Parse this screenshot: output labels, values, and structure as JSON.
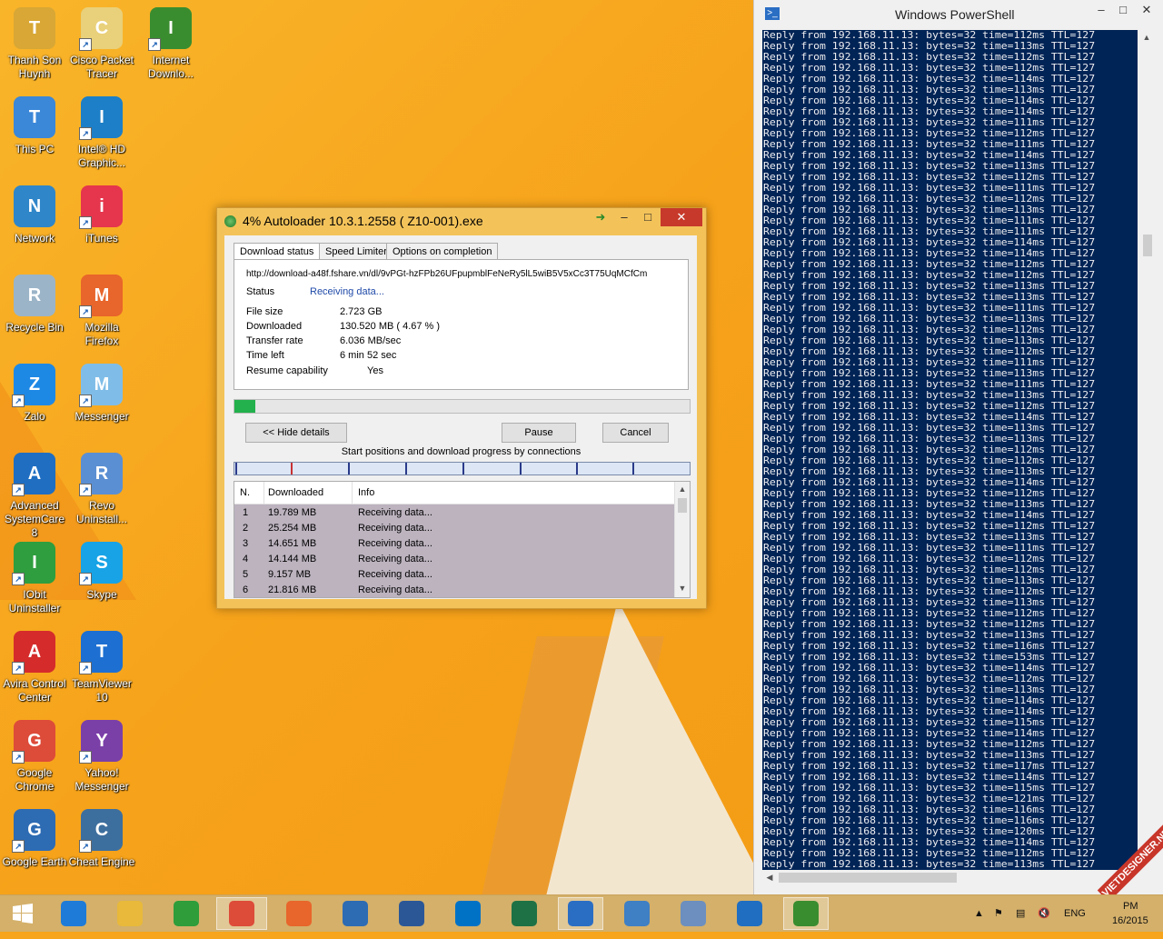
{
  "desktop": {
    "icons": [
      {
        "label": "Thanh Son Huynh",
        "icon": "user-folder-icon",
        "color": "#d8a735"
      },
      {
        "label": "Cisco Packet Tracer",
        "icon": "packet-tracer-icon",
        "color": "#e9d07a"
      },
      {
        "label": "Internet Downlo...",
        "icon": "internet-download-manager-icon",
        "color": "#3a8d2f"
      },
      {
        "label": "This PC",
        "icon": "this-pc-icon",
        "color": "#3b87d8"
      },
      {
        "label": "Intel® HD Graphic...",
        "icon": "intel-graphics-icon",
        "color": "#1d7fc7"
      },
      {
        "label": "Network",
        "icon": "network-icon",
        "color": "#2f86c9"
      },
      {
        "label": "iTunes",
        "icon": "itunes-icon",
        "color": "#e5364d"
      },
      {
        "label": "Recycle Bin",
        "icon": "recycle-bin-icon",
        "color": "#9bb4c8"
      },
      {
        "label": "Mozilla Firefox",
        "icon": "firefox-icon",
        "color": "#e8652b"
      },
      {
        "label": "Zalo",
        "icon": "zalo-icon",
        "color": "#1e88e5"
      },
      {
        "label": "Messenger",
        "icon": "messenger-icon",
        "color": "#7fbde8"
      },
      {
        "label": "Advanced SystemCare 8",
        "icon": "advanced-systemcare-icon",
        "color": "#1f6ec2"
      },
      {
        "label": "Revo Uninstall...",
        "icon": "revo-uninstaller-icon",
        "color": "#5b8fd3"
      },
      {
        "label": "IObit Uninstaller",
        "icon": "iobit-uninstaller-icon",
        "color": "#2e9e3e"
      },
      {
        "label": "Skype",
        "icon": "skype-icon",
        "color": "#17a3e6"
      },
      {
        "label": "Avira Control Center",
        "icon": "avira-icon",
        "color": "#d52b2b"
      },
      {
        "label": "TeamViewer 10",
        "icon": "teamviewer-icon",
        "color": "#1d6fd1"
      },
      {
        "label": "Google Chrome",
        "icon": "chrome-icon",
        "color": "#dd4b39"
      },
      {
        "label": "Yahoo! Messenger",
        "icon": "yahoo-messenger-icon",
        "color": "#7b3fa8"
      },
      {
        "label": "Google Earth",
        "icon": "google-earth-icon",
        "color": "#2d6bb3"
      },
      {
        "label": "Cheat Engine",
        "icon": "cheat-engine-icon",
        "color": "#3d6f9e"
      }
    ]
  },
  "autoloader": {
    "title": "4% Autoloader 10.3.1.2558 ( Z10-001).exe",
    "tabs": [
      "Download status",
      "Speed Limiter",
      "Options on completion"
    ],
    "url": "http://download-a48f.fshare.vn/dl/9vPGt-hzFPb26UFpupmblFeNeRy5lL5wiB5V5xCc3T75UqMCfCm",
    "status_label": "Status",
    "status_value": "Receiving data...",
    "file_size_label": "File size",
    "file_size_value": "2.723  GB",
    "downloaded_label": "Downloaded",
    "downloaded_value": "130.520  MB  ( 4.67 % )",
    "transfer_rate_label": "Transfer rate",
    "transfer_rate_value": "6.036  MB/sec",
    "time_left_label": "Time left",
    "time_left_value": "6 min 52 sec",
    "resume_label": "Resume capability",
    "resume_value": "Yes",
    "progress_fraction": 0.0467,
    "hide_details_label": "<< Hide details",
    "pause_label": "Pause",
    "cancel_label": "Cancel",
    "connections_caption": "Start positions and download progress by connections",
    "table_headers": [
      "N.",
      "Downloaded",
      "Info"
    ],
    "rows": [
      {
        "n": "1",
        "downloaded": "19.789  MB",
        "info": "Receiving data..."
      },
      {
        "n": "2",
        "downloaded": "25.254  MB",
        "info": "Receiving data..."
      },
      {
        "n": "3",
        "downloaded": "14.651  MB",
        "info": "Receiving data..."
      },
      {
        "n": "4",
        "downloaded": "14.144  MB",
        "info": "Receiving data..."
      },
      {
        "n": "5",
        "downloaded": "9.157  MB",
        "info": "Receiving data..."
      },
      {
        "n": "6",
        "downloaded": "21.816  MB",
        "info": "Receiving data..."
      }
    ]
  },
  "powershell": {
    "title": "Windows PowerShell",
    "lines": [
      "Reply from 192.168.11.13: bytes=32 time=112ms TTL=127",
      "Reply from 192.168.11.13: bytes=32 time=113ms TTL=127",
      "Reply from 192.168.11.13: bytes=32 time=112ms TTL=127",
      "Reply from 192.168.11.13: bytes=32 time=112ms TTL=127",
      "Reply from 192.168.11.13: bytes=32 time=114ms TTL=127",
      "Reply from 192.168.11.13: bytes=32 time=113ms TTL=127",
      "Reply from 192.168.11.13: bytes=32 time=114ms TTL=127",
      "Reply from 192.168.11.13: bytes=32 time=114ms TTL=127",
      "Reply from 192.168.11.13: bytes=32 time=111ms TTL=127",
      "Reply from 192.168.11.13: bytes=32 time=112ms TTL=127",
      "Reply from 192.168.11.13: bytes=32 time=111ms TTL=127",
      "Reply from 192.168.11.13: bytes=32 time=114ms TTL=127",
      "Reply from 192.168.11.13: bytes=32 time=113ms TTL=127",
      "Reply from 192.168.11.13: bytes=32 time=112ms TTL=127",
      "Reply from 192.168.11.13: bytes=32 time=111ms TTL=127",
      "Reply from 192.168.11.13: bytes=32 time=112ms TTL=127",
      "Reply from 192.168.11.13: bytes=32 time=113ms TTL=127",
      "Reply from 192.168.11.13: bytes=32 time=111ms TTL=127",
      "Reply from 192.168.11.13: bytes=32 time=111ms TTL=127",
      "Reply from 192.168.11.13: bytes=32 time=114ms TTL=127",
      "Reply from 192.168.11.13: bytes=32 time=114ms TTL=127",
      "Reply from 192.168.11.13: bytes=32 time=112ms TTL=127",
      "Reply from 192.168.11.13: bytes=32 time=112ms TTL=127",
      "Reply from 192.168.11.13: bytes=32 time=113ms TTL=127",
      "Reply from 192.168.11.13: bytes=32 time=113ms TTL=127",
      "Reply from 192.168.11.13: bytes=32 time=111ms TTL=127",
      "Reply from 192.168.11.13: bytes=32 time=113ms TTL=127",
      "Reply from 192.168.11.13: bytes=32 time=112ms TTL=127",
      "Reply from 192.168.11.13: bytes=32 time=113ms TTL=127",
      "Reply from 192.168.11.13: bytes=32 time=112ms TTL=127",
      "Reply from 192.168.11.13: bytes=32 time=111ms TTL=127",
      "Reply from 192.168.11.13: bytes=32 time=113ms TTL=127",
      "Reply from 192.168.11.13: bytes=32 time=111ms TTL=127",
      "Reply from 192.168.11.13: bytes=32 time=113ms TTL=127",
      "Reply from 192.168.11.13: bytes=32 time=112ms TTL=127",
      "Reply from 192.168.11.13: bytes=32 time=114ms TTL=127",
      "Reply from 192.168.11.13: bytes=32 time=113ms TTL=127",
      "Reply from 192.168.11.13: bytes=32 time=113ms TTL=127",
      "Reply from 192.168.11.13: bytes=32 time=112ms TTL=127",
      "Reply from 192.168.11.13: bytes=32 time=112ms TTL=127",
      "Reply from 192.168.11.13: bytes=32 time=113ms TTL=127",
      "Reply from 192.168.11.13: bytes=32 time=114ms TTL=127",
      "Reply from 192.168.11.13: bytes=32 time=112ms TTL=127",
      "Reply from 192.168.11.13: bytes=32 time=113ms TTL=127",
      "Reply from 192.168.11.13: bytes=32 time=114ms TTL=127",
      "Reply from 192.168.11.13: bytes=32 time=112ms TTL=127",
      "Reply from 192.168.11.13: bytes=32 time=113ms TTL=127",
      "Reply from 192.168.11.13: bytes=32 time=111ms TTL=127",
      "Reply from 192.168.11.13: bytes=32 time=112ms TTL=127",
      "Reply from 192.168.11.13: bytes=32 time=112ms TTL=127",
      "Reply from 192.168.11.13: bytes=32 time=113ms TTL=127",
      "Reply from 192.168.11.13: bytes=32 time=112ms TTL=127",
      "Reply from 192.168.11.13: bytes=32 time=113ms TTL=127",
      "Reply from 192.168.11.13: bytes=32 time=112ms TTL=127",
      "Reply from 192.168.11.13: bytes=32 time=112ms TTL=127",
      "Reply from 192.168.11.13: bytes=32 time=113ms TTL=127",
      "Reply from 192.168.11.13: bytes=32 time=116ms TTL=127",
      "Reply from 192.168.11.13: bytes=32 time=153ms TTL=127",
      "Reply from 192.168.11.13: bytes=32 time=114ms TTL=127",
      "Reply from 192.168.11.13: bytes=32 time=112ms TTL=127",
      "Reply from 192.168.11.13: bytes=32 time=113ms TTL=127",
      "Reply from 192.168.11.13: bytes=32 time=114ms TTL=127",
      "Reply from 192.168.11.13: bytes=32 time=114ms TTL=127",
      "Reply from 192.168.11.13: bytes=32 time=115ms TTL=127",
      "Reply from 192.168.11.13: bytes=32 time=114ms TTL=127",
      "Reply from 192.168.11.13: bytes=32 time=112ms TTL=127",
      "Reply from 192.168.11.13: bytes=32 time=113ms TTL=127",
      "Reply from 192.168.11.13: bytes=32 time=117ms TTL=127",
      "Reply from 192.168.11.13: bytes=32 time=114ms TTL=127",
      "Reply from 192.168.11.13: bytes=32 time=115ms TTL=127",
      "Reply from 192.168.11.13: bytes=32 time=121ms TTL=127",
      "Reply from 192.168.11.13: bytes=32 time=116ms TTL=127",
      "Reply from 192.168.11.13: bytes=32 time=116ms TTL=127",
      "Reply from 192.168.11.13: bytes=32 time=120ms TTL=127",
      "Reply from 192.168.11.13: bytes=32 time=114ms TTL=127",
      "Reply from 192.168.11.13: bytes=32 time=112ms TTL=127",
      "Reply from 192.168.11.13: bytes=32 time=113ms TTL=127",
      "Reply from 192.168.11.13: bytes=32 time=111ms TTL=127",
      "Reply from 192.168.11.13: bytes=32 time=117ms TTL=127",
      "Reply from 192.168.11.13: bytes=32 time=112ms TTL=127"
    ]
  },
  "taskbar": {
    "items": [
      {
        "icon": "start-windows-icon",
        "color": "#ffffff"
      },
      {
        "icon": "internet-explorer-icon",
        "color": "#1e7bd8"
      },
      {
        "icon": "file-explorer-icon",
        "color": "#e8b93a"
      },
      {
        "icon": "windows-store-icon",
        "color": "#2e9d3a"
      },
      {
        "icon": "chrome-icon",
        "color": "#dd4b39"
      },
      {
        "icon": "firefox-icon",
        "color": "#e8652b"
      },
      {
        "icon": "google-earth-icon",
        "color": "#2d6bb3"
      },
      {
        "icon": "word-icon",
        "color": "#2b5797"
      },
      {
        "icon": "outlook-icon",
        "color": "#0072c6"
      },
      {
        "icon": "excel-icon",
        "color": "#1e7145"
      },
      {
        "icon": "powershell-icon",
        "color": "#2a6ec4"
      },
      {
        "icon": "remote-desktop-icon",
        "color": "#3f7fc4"
      },
      {
        "icon": "paint-icon",
        "color": "#6c8fbf"
      },
      {
        "icon": "advanced-systemcare-icon",
        "color": "#1f6ec2"
      },
      {
        "icon": "internet-download-manager-icon",
        "color": "#3a8d2f"
      }
    ],
    "language": "ENG",
    "clock_time": "PM",
    "clock_date": "16/2015"
  },
  "watermark": "VIETDESIGNER.NET"
}
